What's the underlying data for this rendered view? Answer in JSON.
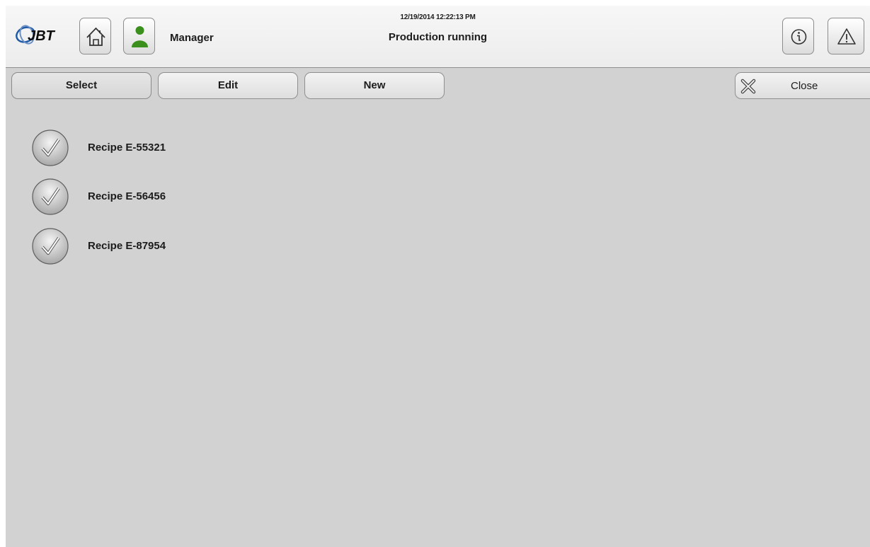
{
  "header": {
    "logo_text": "JBT",
    "user_role": "Manager",
    "datetime": "12/19/2014 12:22:13 PM",
    "status": "Production running",
    "icons": [
      "home-icon",
      "user-icon",
      "info-icon",
      "warning-icon"
    ]
  },
  "tabs": [
    {
      "label": "Select",
      "active": true
    },
    {
      "label": "Edit",
      "active": false
    },
    {
      "label": "New",
      "active": false
    }
  ],
  "close_label": "Close",
  "recipes": [
    {
      "label": "Recipe E-55321"
    },
    {
      "label": "Recipe E-56456"
    },
    {
      "label": "Recipe E-87954"
    }
  ],
  "colors": {
    "background": "#d2d2d2",
    "header": "#f2f2f2",
    "user_icon": "#3a8f1d",
    "logo_blue": "#1f5aa6"
  }
}
